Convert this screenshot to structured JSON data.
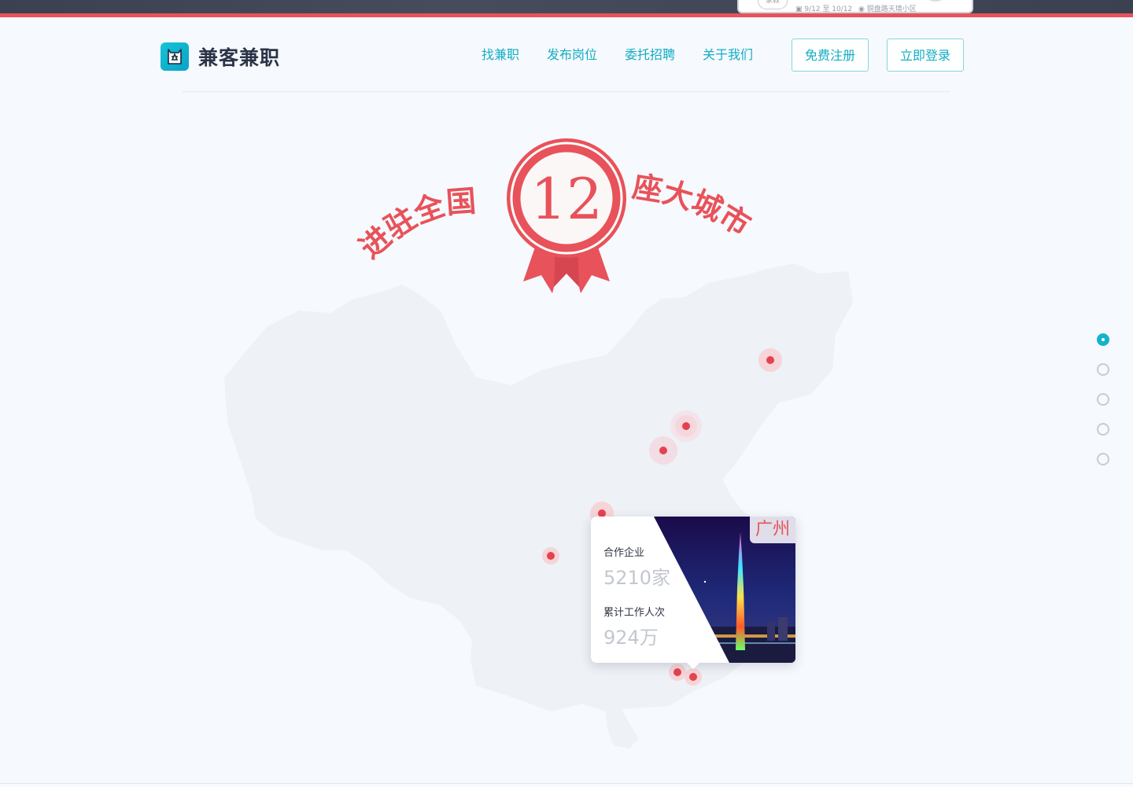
{
  "top_strip": {
    "peek_tag": "家教",
    "peek_date": "9/12 至 10/12",
    "peek_location": "铜盘路天境小区"
  },
  "header": {
    "logo_text": "兼客兼职",
    "nav": [
      "找兼职",
      "发布岗位",
      "委托招聘",
      "关于我们"
    ],
    "register_label": "免费注册",
    "login_label": "立即登录"
  },
  "hero": {
    "left_text": "进驻全国",
    "number": "12",
    "right_text": "座大城市"
  },
  "popup": {
    "city": "广州",
    "partners_label": "合作企业",
    "partners_value": "5210家",
    "workers_label": "累计工作人次",
    "workers_value": "924万"
  },
  "side_nav": {
    "count": 5,
    "active_index": 0
  },
  "colors": {
    "accent": "#12adc3",
    "brand_red": "#e8525a",
    "map_fill": "#eef1f6"
  }
}
